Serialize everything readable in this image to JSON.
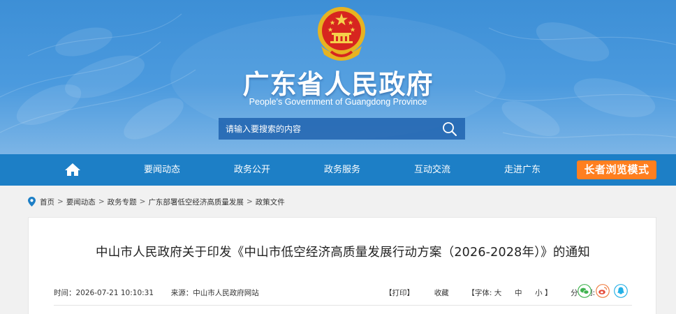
{
  "header": {
    "title": "广东省人民政府",
    "subtitle": "People's Government of Guangdong Province",
    "emblem": "national-emblem"
  },
  "search": {
    "placeholder": "请输入要搜索的内容",
    "icon": "search-icon"
  },
  "nav": {
    "home_icon": "home-icon",
    "items": [
      {
        "label": "要闻动态"
      },
      {
        "label": "政务公开"
      },
      {
        "label": "政务服务"
      },
      {
        "label": "互动交流"
      },
      {
        "label": "走进广东"
      }
    ],
    "elder_mode": "长者浏览模式"
  },
  "breadcrumb": {
    "icon": "location-pin-icon",
    "items": [
      "首页",
      "要闻动态",
      "政务专题",
      "广东部署低空经济高质量发展",
      "政策文件"
    ],
    "separator": ">"
  },
  "article": {
    "title": "中山市人民政府关于印发《中山市低空经济高质量发展行动方案（2026-2028年）》的通知",
    "time_label": "时间：",
    "time": "2026-07-21 10:10:31",
    "source_label": "来源：",
    "source": "中山市人民政府网站",
    "print": "【打印】",
    "favorite": "收藏",
    "font_label": "【字体:",
    "font_large": "大",
    "font_medium": "中",
    "font_small": "小",
    "font_close": "】",
    "share_label": "分享到:",
    "share_icons": [
      "wechat-icon",
      "weibo-icon",
      "qq-icon"
    ]
  },
  "colors": {
    "header_blue": "#4b9ade",
    "nav_blue": "#1d7fc6",
    "elder_orange": "#ff7f1f",
    "wechat_green": "#3fb34f",
    "weibo_orange": "#f07b3f",
    "qq_cyan": "#23b0e6"
  }
}
